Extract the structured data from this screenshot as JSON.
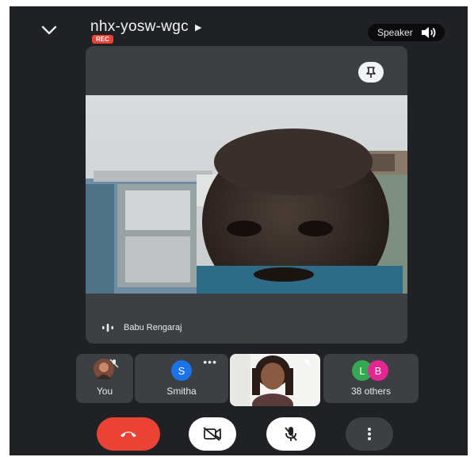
{
  "header": {
    "meeting_code": "nhx-yosw-wgc",
    "rec_badge": "REC",
    "audio_output_label": "Speaker"
  },
  "main_tile": {
    "participant_name": "Babu Rengaraj"
  },
  "participants": {
    "you_label": "You",
    "smitha_initial": "S",
    "smitha_label": "Smitha",
    "others_initial_1": "L",
    "others_initial_2": "B",
    "others_label": "38 others",
    "more_dots": "•••"
  },
  "controls": {
    "end_call": "end-call",
    "camera": "camera-off",
    "mic": "mic-off",
    "more": "more-options"
  },
  "colors": {
    "background": "#202124",
    "tile": "#3c4043",
    "rec": "#ea4335",
    "end_call": "#ea4335",
    "avatar_s": "#1a73e8",
    "avatar_l": "#34a853",
    "avatar_b": "#e52592"
  },
  "icons": [
    "chevron-down-icon",
    "play-arrow-icon",
    "speaker-icon",
    "pin-icon",
    "audio-level-icon",
    "mic-off-icon",
    "hang-up-icon",
    "camera-off-icon",
    "more-vert-icon"
  ]
}
